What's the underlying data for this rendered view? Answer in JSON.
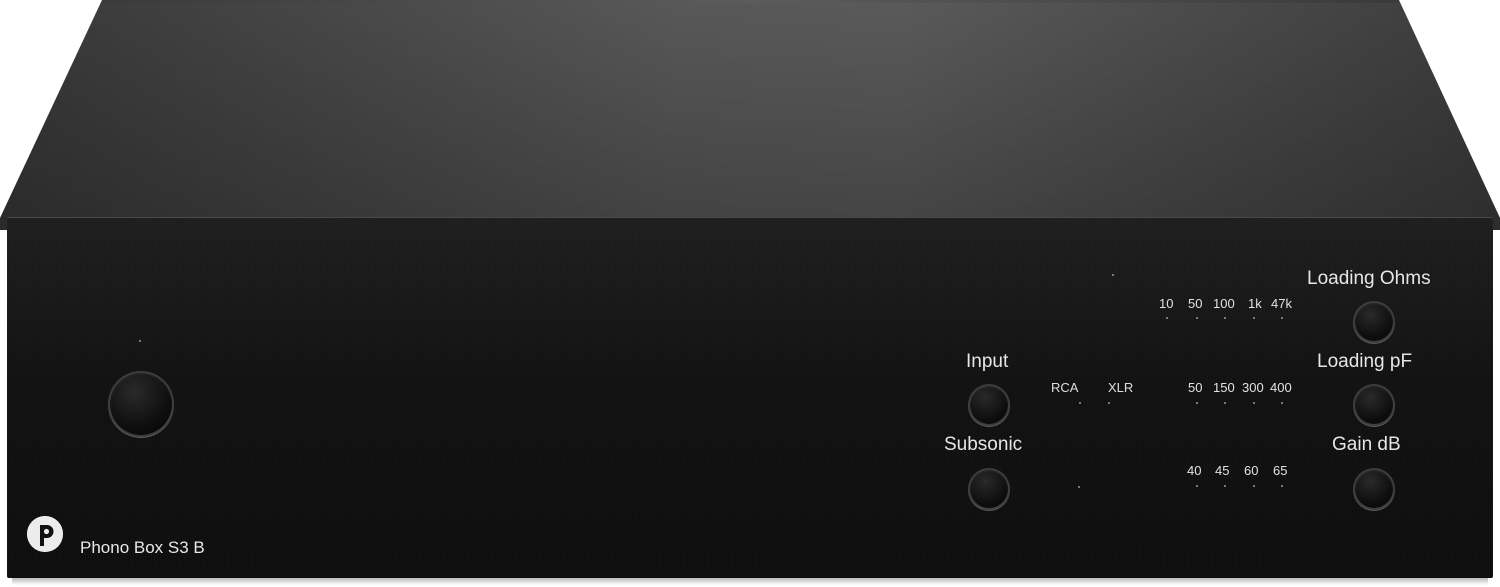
{
  "device": {
    "model": "Phono Box S3 B",
    "brand_icon": "pro-ject-logo-icon"
  },
  "controls": {
    "input": "Input",
    "subsonic": "Subsonic",
    "loading_ohms": "Loading Ohms",
    "loading_pf": "Loading pF",
    "gain_db": "Gain dB"
  },
  "indicators": {
    "input_options": [
      "RCA",
      "XLR"
    ],
    "ohms_options": [
      "10",
      "50",
      "100",
      "1k",
      "47k"
    ],
    "pf_options": [
      "50",
      "150",
      "300",
      "400"
    ],
    "gain_options": [
      "40",
      "45",
      "60",
      "65"
    ]
  }
}
